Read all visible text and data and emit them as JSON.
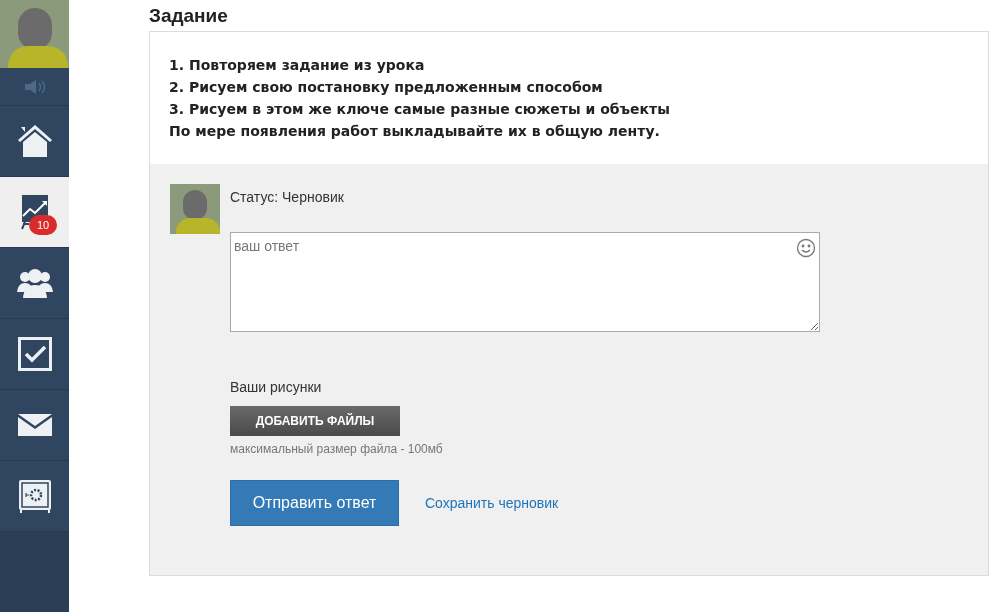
{
  "sidebar": {
    "items": [
      {
        "kind": "home",
        "selected": false
      },
      {
        "kind": "chart",
        "selected": true,
        "badge": "10"
      },
      {
        "kind": "group",
        "selected": false
      },
      {
        "kind": "check",
        "selected": false
      },
      {
        "kind": "mail",
        "selected": false
      },
      {
        "kind": "safe",
        "selected": false
      }
    ]
  },
  "title": "Задание",
  "task_lines": [
    "1. Повторяем задание из урока",
    "2. Рисуем свою постановку предложенным способом",
    "3. Рисуем в этом же ключе самые разные сюжеты и объекты",
    "По мере появления работ выкладывайте их в общую ленту."
  ],
  "answer": {
    "status": "Статус: Черновик",
    "placeholder": "ваш ответ",
    "files_label": "Ваши рисунки",
    "add_files_button": "ДОБАВИТЬ ФАЙЛЫ",
    "size_hint": "максимальный размер файла - 100мб",
    "submit_button": "Отправить ответ",
    "save_link": "Сохранить черновик"
  }
}
